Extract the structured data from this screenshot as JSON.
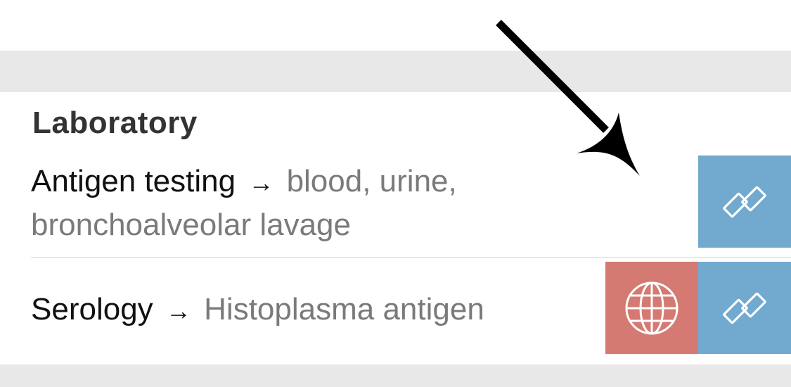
{
  "section": {
    "title": "Laboratory"
  },
  "rows": [
    {
      "label": "Antigen testing",
      "arrow": "→",
      "detail": "blood, urine, bronchoalveolar lavage",
      "actions": [
        {
          "icon": "link-icon",
          "color": "#72a9cf"
        }
      ]
    },
    {
      "label": "Serology",
      "arrow": "→",
      "detail": "Histoplasma antigen",
      "actions": [
        {
          "icon": "globe-icon",
          "color": "#d47a72"
        },
        {
          "icon": "link-icon",
          "color": "#72a9cf"
        }
      ]
    }
  ],
  "colors": {
    "band_gray": "#e8e8e8",
    "link_blue": "#72a9cf",
    "web_red": "#d47a72",
    "detail_gray": "#7a7a7a"
  }
}
